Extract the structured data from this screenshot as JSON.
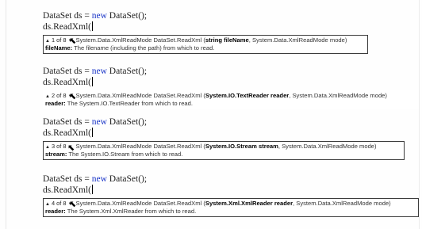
{
  "blocks": [
    {
      "line1": {
        "pre": "DataSet ds = ",
        "kw": "new",
        "post": " DataSet();"
      },
      "line2": "ds.ReadXml(",
      "tip": {
        "up": "▲",
        "counter": "1 of 8",
        "down": "▼",
        "sig_pre": "System.Data.XmlReadMode DataSet.ReadXml (",
        "sig_bold": "string fileName",
        "sig_post": ", System.Data.XmlReadMode mode)",
        "param_name": "fileName:",
        "param_desc": " The filename (including the path) from which to read."
      }
    },
    {
      "line1": {
        "pre": "DataSet ds = ",
        "kw": "new",
        "post": " DataSet();"
      },
      "line2": "ds.ReadXml(",
      "tip": {
        "up": "▲",
        "counter": "2 of 8",
        "down": "▼",
        "sig_pre": "System.Data.XmlReadMode DataSet.ReadXml (",
        "sig_bold": "System.IO.TextReader reader",
        "sig_post": ", System.Data.XmlReadMode mode)",
        "param_name": "reader:",
        "param_desc": " The System.IO.TextReader from which to read."
      }
    },
    {
      "line1": {
        "pre": "DataSet ds = ",
        "kw": "new",
        "post": " DataSet();"
      },
      "line2": "ds.ReadXml(",
      "tip": {
        "up": "▲",
        "counter": "3 of 8",
        "down": "▼",
        "sig_pre": "System.Data.XmlReadMode DataSet.ReadXml (",
        "sig_bold": "System.IO.Stream stream",
        "sig_post": ", System.Data.XmlReadMode mode)",
        "param_name": "stream:",
        "param_desc": " The System.IO.Stream from which to read."
      }
    },
    {
      "line1": {
        "pre": "DataSet ds = ",
        "kw": "new",
        "post": " DataSet();"
      },
      "line2": "ds.ReadXml(",
      "tip": {
        "up": "▲",
        "counter": "4 of 8",
        "down": "▼",
        "sig_pre": "System.Data.XmlReadMode DataSet.ReadXml (",
        "sig_bold": "System.Xml.XmlReader reader",
        "sig_post": ", System.Data.XmlReadMode mode)",
        "param_name": "reader:",
        "param_desc": " The System.Xml.XmlReader from which to read."
      }
    }
  ]
}
